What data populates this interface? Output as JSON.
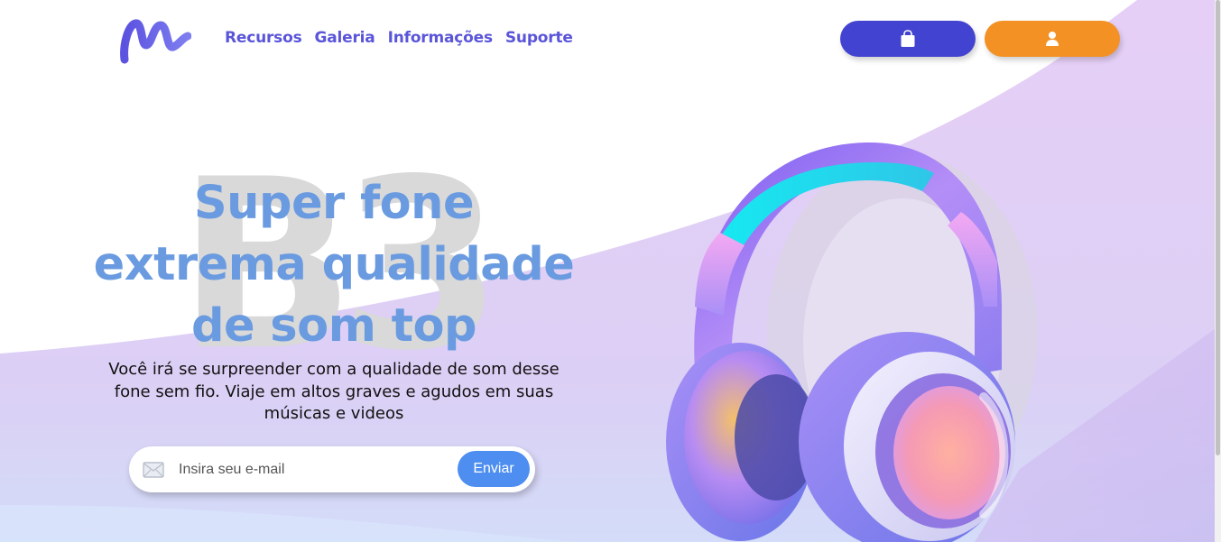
{
  "nav": {
    "items": [
      {
        "label": "Recursos"
      },
      {
        "label": "Galeria"
      },
      {
        "label": "Informações"
      },
      {
        "label": "Suporte"
      }
    ]
  },
  "actions": {
    "cart_icon": "shopping-bag-icon",
    "user_icon": "user-icon"
  },
  "hero": {
    "bg_text": "B3",
    "title_lines": [
      "Super fone",
      "extrema qualidade",
      "de som top"
    ],
    "description": "Você irá se surpreender com a qualidade de som desse fone sem fio. Viaje em altos graves e agudos em suas músicas e videos"
  },
  "subscribe": {
    "placeholder": "Insira seu e-mail",
    "button_label": "Enviar",
    "icon": "mail-icon"
  },
  "colors": {
    "brand_purple": "#5a55d9",
    "cart_button": "#4343d1",
    "user_button": "#f39124",
    "title_blue": "#6a9be0",
    "send_button": "#4d8ef0",
    "lavender_bg": "#e3d1f6"
  }
}
